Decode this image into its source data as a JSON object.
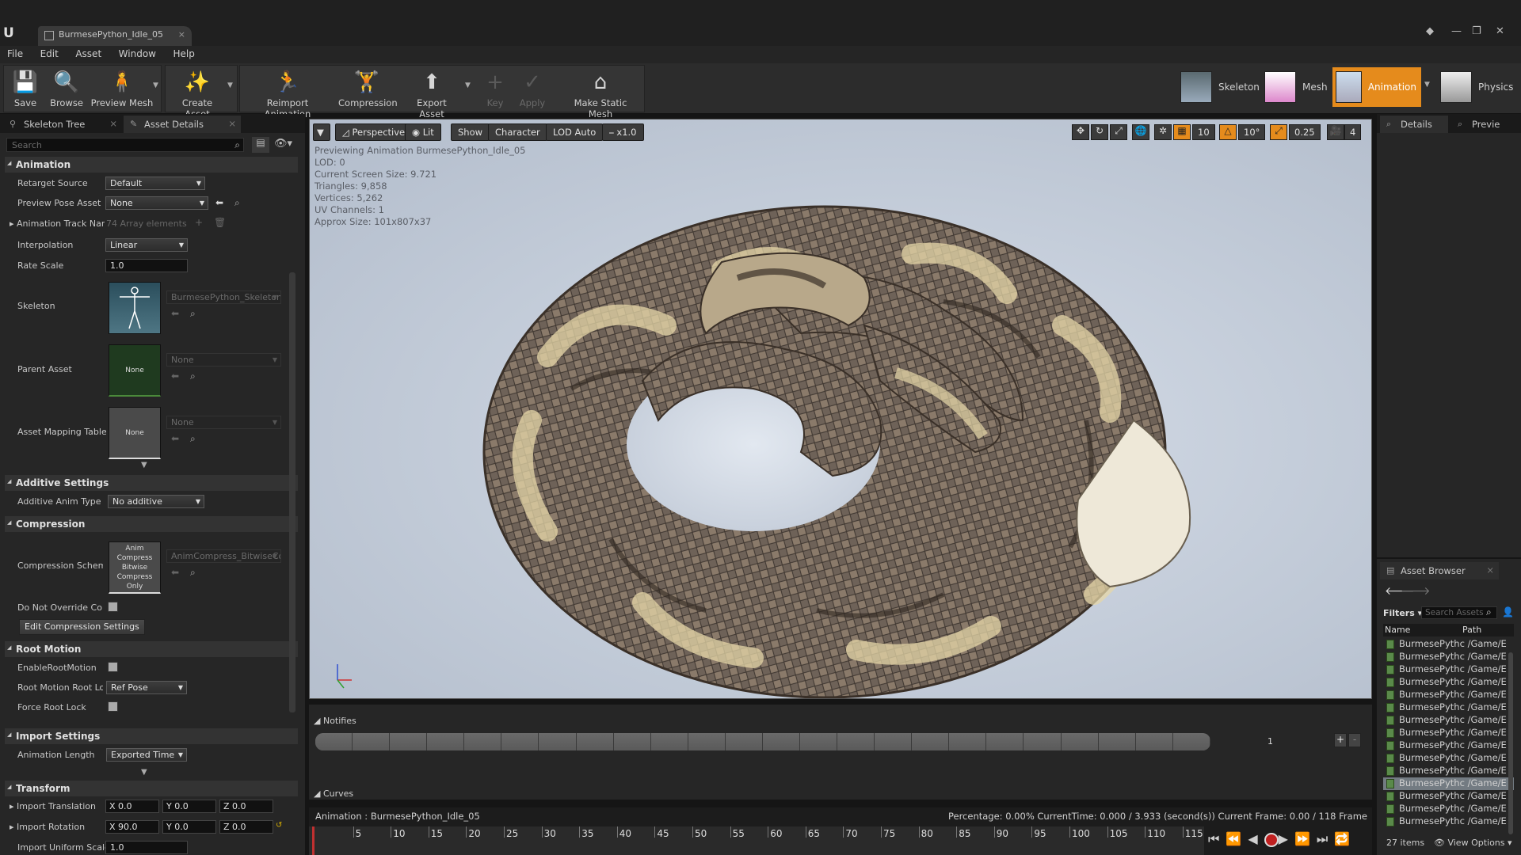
{
  "window": {
    "tab_title": "BurmesePython_Idle_05"
  },
  "menu": [
    "File",
    "Edit",
    "Asset",
    "Window",
    "Help"
  ],
  "toolbar": {
    "buttons": [
      {
        "label": "Save",
        "icon": "save-icon"
      },
      {
        "label": "Browse",
        "icon": "magnifier-icon"
      },
      {
        "label": "Preview Mesh",
        "icon": "preview-mesh-icon"
      },
      {
        "label": "Create Asset",
        "icon": "create-asset-icon"
      },
      {
        "label": "Reimport Animation",
        "icon": "reimport-icon"
      },
      {
        "label": "Compression",
        "icon": "compression-icon"
      },
      {
        "label": "Export Asset",
        "icon": "export-icon"
      },
      {
        "label": "Key",
        "icon": "plus-icon"
      },
      {
        "label": "Apply",
        "icon": "check-icon"
      },
      {
        "label": "Make Static Mesh",
        "icon": "static-mesh-icon"
      }
    ],
    "modes": [
      "Skeleton",
      "Mesh",
      "Animation",
      "Physics"
    ]
  },
  "left_panel": {
    "tabs": [
      "Skeleton Tree",
      "Asset Details"
    ],
    "search_placeholder": "Search",
    "animation": {
      "title": "Animation",
      "retarget_source_label": "Retarget Source",
      "retarget_source_value": "Default",
      "preview_pose_label": "Preview Pose Asset",
      "preview_pose_value": "None",
      "track_names_label": "Animation Track Nam",
      "track_names_value": "74 Array elements",
      "interpolation_label": "Interpolation",
      "interpolation_value": "Linear",
      "rate_scale_label": "Rate Scale",
      "rate_scale_value": "1.0",
      "skeleton_label": "Skeleton",
      "skeleton_value": "BurmesePython_Skeleton",
      "parent_asset_label": "Parent Asset",
      "parent_asset_thumb": "None",
      "parent_asset_value": "None",
      "mapping_label": "Asset Mapping Table",
      "mapping_thumb": "None",
      "mapping_value": "None"
    },
    "additive": {
      "title": "Additive Settings",
      "type_label": "Additive Anim Type",
      "type_value": "No additive"
    },
    "compression": {
      "title": "Compression",
      "scheme_label": "Compression Scheme",
      "scheme_thumb": "Anim Compress Bitwise Compress Only",
      "scheme_value": "AnimCompress_BitwiseCo",
      "override_label": "Do Not Override Comp",
      "edit_button": "Edit Compression Settings"
    },
    "root_motion": {
      "title": "Root Motion",
      "enable_label": "EnableRootMotion",
      "lock_label": "Root Motion Root Loc",
      "lock_value": "Ref Pose",
      "force_label": "Force Root Lock"
    },
    "import": {
      "title": "Import Settings",
      "length_label": "Animation Length",
      "length_value": "Exported Time"
    },
    "transform": {
      "title": "Transform",
      "translation_label": "Import Translation",
      "translation": [
        "X 0.0",
        "Y 0.0",
        "Z 0.0"
      ],
      "rotation_label": "Import Rotation",
      "rotation": [
        "X 90.0",
        "Y 0.0",
        "Z 0.0"
      ],
      "scale_label": "Import Uniform Scale",
      "scale_value": "1.0"
    }
  },
  "viewport": {
    "buttons": [
      "Perspective",
      "Lit",
      "Show",
      "Character",
      "LOD Auto",
      "x1.0"
    ],
    "grid_snap": "10",
    "rot_snap": "10°",
    "scale_snap": "0.25",
    "cam_speed": "4",
    "stats": [
      "Previewing Animation BurmesePython_Idle_05",
      "LOD: 0",
      "Current Screen Size: 9.721",
      "Triangles: 9,858",
      "Vertices: 5,262",
      "UV Channels: 1",
      "Approx Size: 101x807x37"
    ]
  },
  "notifies": {
    "label": "Notifies",
    "track_number": "1",
    "curves_label": "Curves"
  },
  "timeline": {
    "animation_label": "Animation :  BurmesePython_Idle_05",
    "status": "Percentage:  0.00% CurrentTime:  0.000 / 3.933 (second(s)) Current Frame:  0.00 / 118 Frame",
    "ticks": [
      "5",
      "10",
      "15",
      "20",
      "25",
      "30",
      "35",
      "40",
      "45",
      "50",
      "55",
      "60",
      "65",
      "70",
      "75",
      "80",
      "85",
      "90",
      "95",
      "100",
      "105",
      "110",
      "115"
    ]
  },
  "right_panel": {
    "tabs": [
      "Details",
      "Previe"
    ]
  },
  "asset_browser": {
    "title": "Asset Browser",
    "filters": "Filters",
    "search_placeholder": "Search Assets",
    "col_name": "Name",
    "col_path": "Path",
    "rows": [
      "BurmesePythc /Game/E",
      "BurmesePythc /Game/E",
      "BurmesePythc /Game/E",
      "BurmesePythc /Game/E",
      "BurmesePythc /Game/E",
      "BurmesePythc /Game/E",
      "BurmesePythc /Game/E",
      "BurmesePythc /Game/E",
      "BurmesePythc /Game/E",
      "BurmesePythc /Game/E",
      "BurmesePythc /Game/E",
      "BurmesePythc /Game/E",
      "BurmesePythc /Game/E",
      "BurmesePythc /Game/E",
      "BurmesePythc /Game/E"
    ],
    "selected_index": 11,
    "count": "27 items",
    "view_options": "View Options"
  }
}
